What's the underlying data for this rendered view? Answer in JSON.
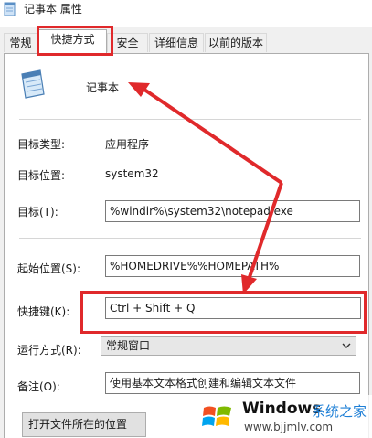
{
  "window": {
    "title": "记事本 属性"
  },
  "tabs": [
    {
      "label": "常规"
    },
    {
      "label": "快捷方式",
      "active": true
    },
    {
      "label": "安全"
    },
    {
      "label": "详细信息"
    },
    {
      "label": "以前的版本"
    }
  ],
  "shortcut": {
    "name": "记事本"
  },
  "fields": {
    "target_type_label": "目标类型:",
    "target_type_value": "应用程序",
    "target_location_label": "目标位置:",
    "target_location_value": "system32",
    "target_label": "目标(T):",
    "target_value": "%windir%\\system32\\notepad.exe",
    "start_in_label": "起始位置(S):",
    "start_in_value": "%HOMEDRIVE%%HOMEPATH%",
    "hotkey_label": "快捷键(K):",
    "hotkey_value": "Ctrl + Shift + Q",
    "run_label": "运行方式(R):",
    "run_value": "常规窗口",
    "comment_label": "备注(O):",
    "comment_value": "使用基本文本格式创建和编辑文本文件"
  },
  "buttons": {
    "open_location": "打开文件所在的位置"
  },
  "watermark": {
    "brand": "Windows",
    "site_name": "系统之家",
    "url": "www.bjjmlv.com"
  },
  "colors": {
    "highlight": "#e0292b",
    "brand_blue": "#1e7fd6"
  }
}
